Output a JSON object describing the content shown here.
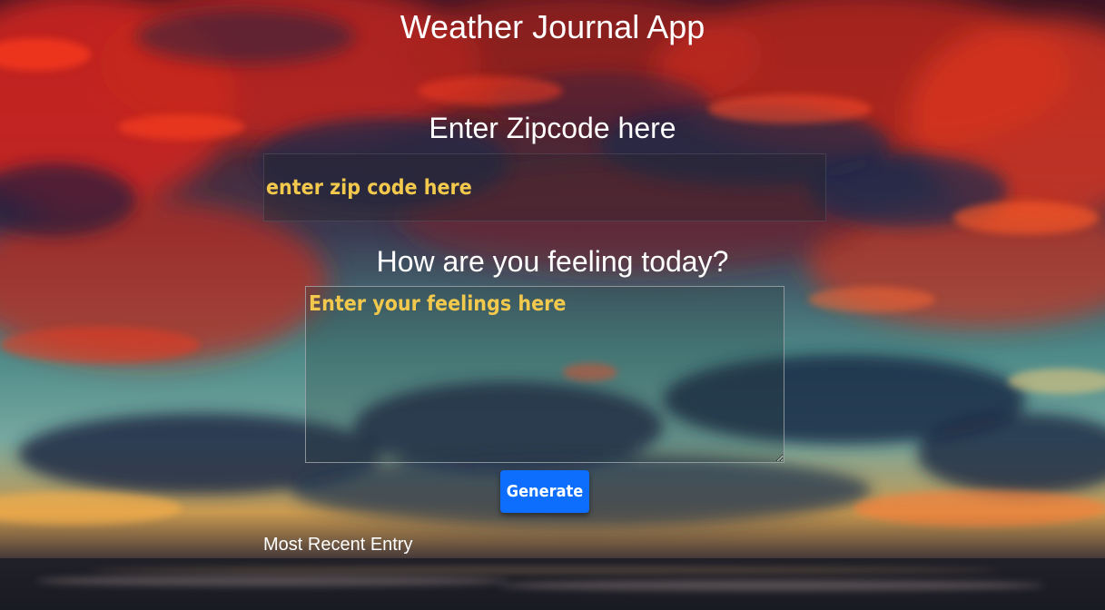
{
  "header": {
    "title": "Weather Journal App"
  },
  "zip": {
    "label": "Enter Zipcode here",
    "value": "",
    "placeholder": "enter zip code here"
  },
  "feelings": {
    "label": "How are you feeling today?",
    "value": "",
    "placeholder": "Enter your feelings here"
  },
  "generate": {
    "label": "Generate"
  },
  "recent": {
    "title": "Most Recent Entry"
  },
  "colors": {
    "placeholder_text": "#f2c94c",
    "button": "#0d6efd",
    "text": "#ffffff"
  }
}
